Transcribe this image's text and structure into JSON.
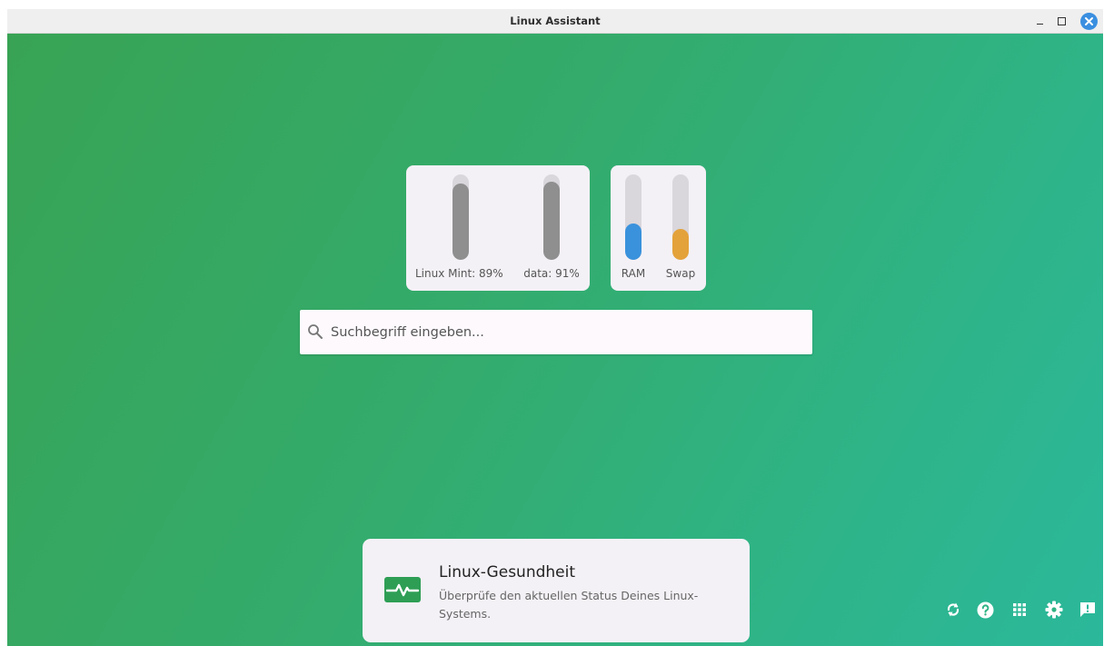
{
  "window": {
    "title": "Linux Assistant"
  },
  "meters": {
    "disks": [
      {
        "label": "Linux Mint: 89%",
        "value": 0.89
      },
      {
        "label": "data: 91%",
        "value": 0.91
      }
    ],
    "memory": [
      {
        "label": "RAM",
        "value": 0.43
      },
      {
        "label": "Swap",
        "value": 0.36
      }
    ]
  },
  "search": {
    "placeholder": "Suchbegriff eingeben...",
    "value": ""
  },
  "health_card": {
    "title": "Linux-Gesundheit",
    "description": "Überprüfe den aktuellen Status Deines Linux-Systems.",
    "icon": "heartbeat-icon"
  },
  "toolbar": {
    "icons": [
      "refresh-icon",
      "help-icon",
      "apps-grid-icon",
      "settings-icon",
      "feedback-icon"
    ]
  },
  "colors": {
    "accent_green": "#2e9e55",
    "ram_blue": "#3a92dc",
    "swap_orange": "#e4a23a",
    "disk_gray": "#8f8f8f",
    "close_blue": "#3a8fe0"
  }
}
